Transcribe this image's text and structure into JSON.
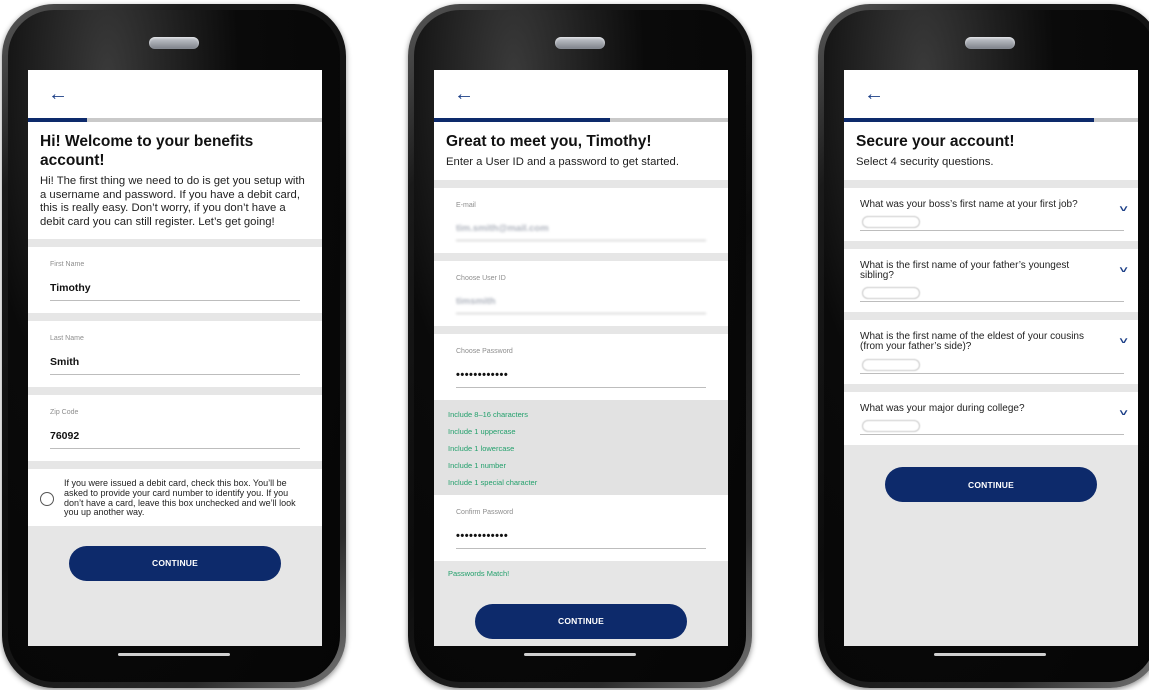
{
  "screen1": {
    "back_icon": "arrow-left-icon",
    "progress": 0.2,
    "title": "Hi! Welcome to your benefits account!",
    "intro": "Hi! The first thing we need to do is get you setup with a username and password. If you have a debit card, this is really easy. Don’t worry, if you don’t have a debit card you can still register. Let’s get going!",
    "fields": [
      {
        "label": "First Name",
        "value": "Timothy"
      },
      {
        "label": "Last Name",
        "value": "Smith"
      },
      {
        "label": "Zip Code",
        "value": "76092"
      }
    ],
    "checkbox_text": "If you were issued a debit card, check this box. You’ll be asked to provide your card number to identify you. If you don’t have a card, leave this box unchecked and we’ll look you up another way.",
    "continue": "CONTINUE"
  },
  "screen2": {
    "back_icon": "arrow-left-icon",
    "progress": 0.6,
    "title": "Great to meet you, Timothy!",
    "subtitle": "Enter a User ID and a password to get started.",
    "email_label": "E-mail",
    "email_value": "tim.smith@mail.com",
    "userid_label": "Choose User ID",
    "userid_value": "timsmith",
    "password_label": "Choose Password",
    "password_value": "••••••••••••",
    "rules": [
      "Include 8–16 characters",
      "Include 1 uppercase",
      "Include 1 lowercase",
      "Include 1 number",
      "Include 1 special character"
    ],
    "confirm_label": "Confirm Password",
    "confirm_value": "••••••••••••",
    "match": "Passwords Match!",
    "continue": "CONTINUE"
  },
  "screen3": {
    "back_icon": "arrow-left-icon",
    "progress": 0.85,
    "title": "Secure your account!",
    "subtitle": "Select 4 security questions.",
    "questions": [
      "What was your boss’s first name at your first job?",
      "What is the first name of your father’s youngest sibling?",
      "What is the first name of the eldest of your cousins (from your father’s side)?",
      "What was your major during college?"
    ],
    "continue": "CONTINUE"
  },
  "colors": {
    "brand": "#0d2a6b",
    "success": "#23a06c"
  }
}
